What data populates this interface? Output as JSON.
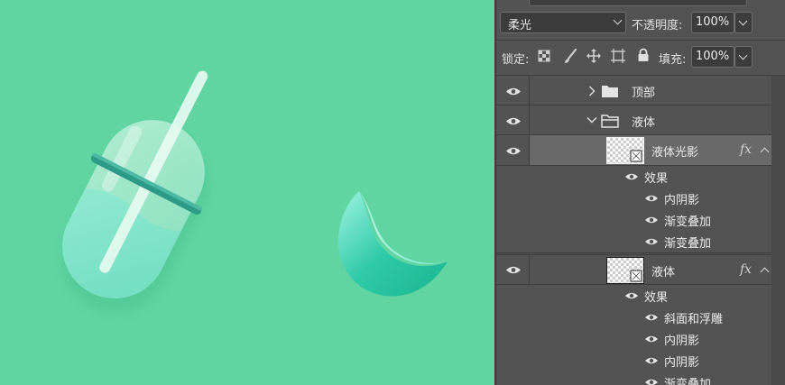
{
  "panel": {
    "blend_mode": "柔光",
    "opacity_label": "不透明度:",
    "opacity_value": "100%",
    "lock_label": "锁定:",
    "fill_label": "填充:",
    "fill_value": "100%"
  },
  "layers": {
    "group_top": "顶部",
    "group_liquid": "液体",
    "layer_liquid_light": "液体光影",
    "layer_liquid": "液体",
    "fx": "fx",
    "effects_label": "效果",
    "effects_light": [
      "内阴影",
      "渐变叠加",
      "渐变叠加"
    ],
    "effects_liquid": [
      "斜面和浮雕",
      "内阴影",
      "内阴影",
      "渐变叠加"
    ]
  },
  "colors": {
    "canvas_bg": "#60d5a2",
    "panel_bg": "#535353",
    "selected_row": "#696969"
  }
}
